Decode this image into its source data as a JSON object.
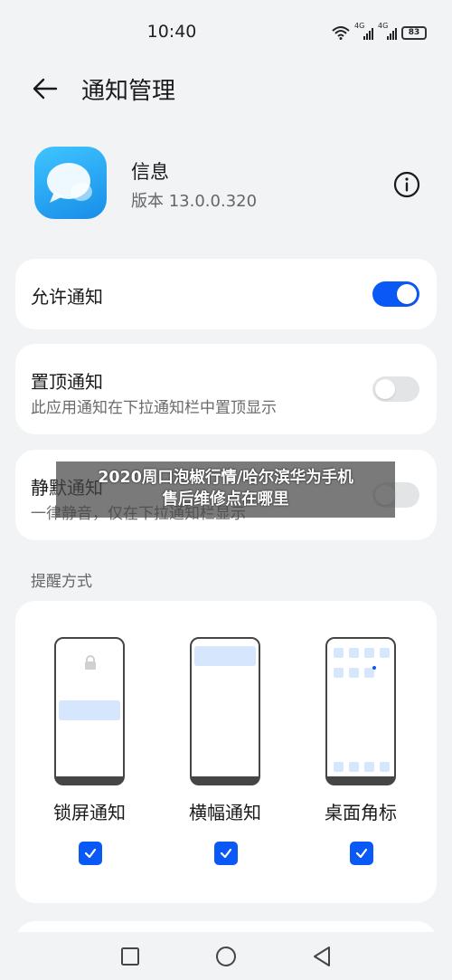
{
  "status_bar": {
    "time": "10:40",
    "network_1": "4G",
    "network_2": "4G",
    "battery": "83"
  },
  "header": {
    "title": "通知管理"
  },
  "app": {
    "name": "信息",
    "version": "版本 13.0.0.320"
  },
  "settings": {
    "allow_notifications": {
      "label": "允许通知",
      "enabled": true
    },
    "pin_to_top": {
      "label": "置顶通知",
      "description": "此应用通知在下拉通知栏中置顶显示",
      "enabled": false
    },
    "silent": {
      "label": "静默通知",
      "description": "一律静音，仅在下拉通知栏显示",
      "enabled": false
    }
  },
  "reminder": {
    "section_title": "提醒方式",
    "options": [
      {
        "label": "锁屏通知",
        "checked": true
      },
      {
        "label": "横幅通知",
        "checked": true
      },
      {
        "label": "桌面角标",
        "checked": true
      }
    ]
  },
  "watermark": {
    "line1": "2020周口泡椒行情/哈尔滨华为手机",
    "line2": "售后维修点在哪里"
  },
  "colors": {
    "accent": "#0a59f7",
    "background": "#f1f3f5",
    "card": "#ffffff"
  },
  "nav": {
    "icons": [
      "square-icon",
      "circle-icon",
      "triangle-back-icon"
    ]
  }
}
